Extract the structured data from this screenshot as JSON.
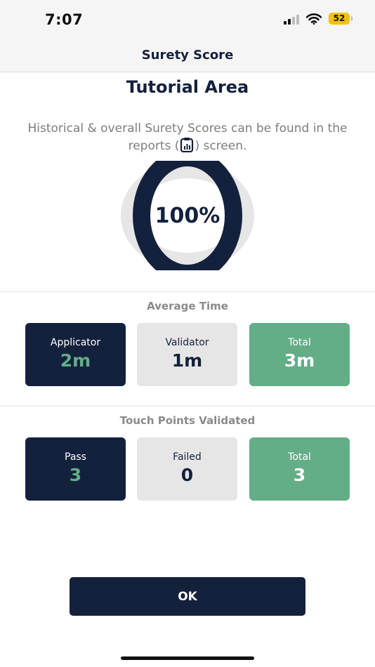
{
  "status_bar": {
    "time": "7:07",
    "battery_level": "52",
    "signal_bars_active": 2,
    "signal_bars_total": 4
  },
  "nav": {
    "title": "Surety Score"
  },
  "page": {
    "title": "Tutorial Area",
    "intro_before": "Historical & overall Surety Scores can be found in the reports (",
    "intro_icon": "clipboard-chart-icon",
    "intro_after": ") screen."
  },
  "score": {
    "value_text": "100%",
    "value": 100
  },
  "average_time": {
    "title": "Average Time",
    "cards": [
      {
        "label": "Applicator",
        "value": "2m"
      },
      {
        "label": "Validator",
        "value": "1m"
      },
      {
        "label": "Total",
        "value": "3m"
      }
    ]
  },
  "touch_points": {
    "title": "Touch Points Validated",
    "cards": [
      {
        "label": "Pass",
        "value": "3"
      },
      {
        "label": "Failed",
        "value": "0"
      },
      {
        "label": "Total",
        "value": "3"
      }
    ]
  },
  "actions": {
    "ok_label": "OK"
  },
  "colors": {
    "navy": "#14213d",
    "green": "#63ad87",
    "light_gray": "#e6e6e6",
    "battery_yellow": "#f2c200"
  }
}
